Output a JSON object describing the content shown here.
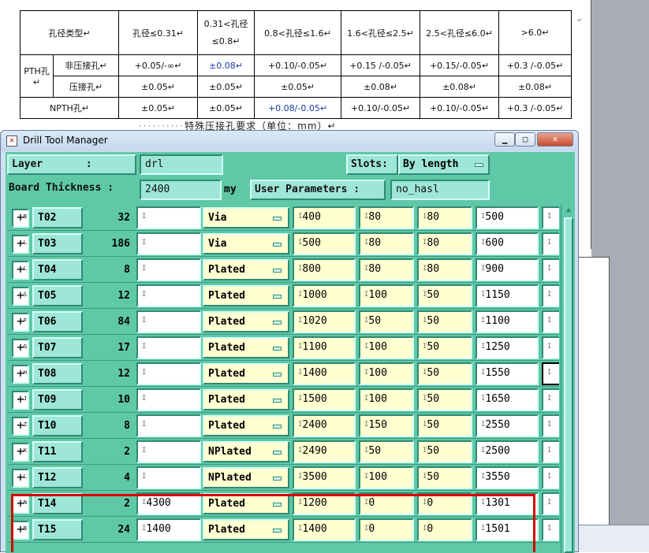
{
  "document": {
    "table": {
      "header": [
        "孔径类型↵",
        "孔径≤0.31↵",
        "0.31<孔径≤0.8↵",
        "0.8<孔径≤1.6↵",
        "1.6<孔径≤2.5↵",
        "2.5<孔径≤6.0↵",
        ">6.0↵"
      ],
      "pth_label": "PTH孔↵",
      "rows": [
        {
          "sub": "非压接孔↵",
          "cells": [
            "+0.05/-∞↵",
            "±0.08↵",
            "+0.10/-0.05↵",
            "+0.15 /-0.05↵",
            "+0.15/-0.05↵",
            "+0.3 /-0.05↵"
          ]
        },
        {
          "sub": "压接孔↵",
          "cells": [
            "±0.05↵",
            "±0.05↵",
            "±0.05↵",
            "±0.08↵",
            "±0.08↵",
            "±0.08↵"
          ]
        },
        {
          "sub": "NPTH孔↵",
          "cells": [
            "±0.05↵",
            "±0.05↵",
            "+0.08/-0.05↵",
            "+0.10/-0.05↵",
            "+0.10/-0.05↵",
            "+0.3 /-0.05↵"
          ]
        }
      ],
      "end_mark": "↵"
    },
    "caption_dots": "··········",
    "caption": "特殊压接孔要求（单位：mm）↵"
  },
  "window": {
    "title": "Drill Tool Manager",
    "icon": "x-window-icon",
    "layer_label": "Layer       :",
    "layer_value": "drl",
    "slots_label": "Slots:",
    "slots_value": "By length",
    "thickness_label": "Board Thickness :",
    "thickness_value": "2400",
    "thickness_unit": "my",
    "user_params_label": "User Parameters :",
    "user_params_value": "no_hasl"
  },
  "tools": [
    {
      "exp": "B",
      "name": "T02",
      "count": "32",
      "c1": "",
      "type": "Via",
      "v1": "400",
      "v2": "80",
      "v3": "80",
      "v4": "500"
    },
    {
      "exp": "L",
      "name": "T03",
      "count": "186",
      "c1": "",
      "type": "Via",
      "v1": "500",
      "v2": "80",
      "v3": "80",
      "v4": "600"
    },
    {
      "exp": "L",
      "name": "T04",
      "count": "8",
      "c1": "",
      "type": "Plated",
      "v1": "800",
      "v2": "80",
      "v3": "80",
      "v4": "900"
    },
    {
      "exp": "S",
      "name": "T05",
      "count": "12",
      "c1": "",
      "type": "Plated",
      "v1": "1000",
      "v2": "100",
      "v3": "50",
      "v4": "1150"
    },
    {
      "exp": "F",
      "name": "T06",
      "count": "84",
      "c1": "",
      "type": "Plated",
      "v1": "1020",
      "v2": "50",
      "v3": "50",
      "v4": "1100"
    },
    {
      "exp": "G",
      "name": "T07",
      "count": "17",
      "c1": "",
      "type": "Plated",
      "v1": "1100",
      "v2": "100",
      "v3": "50",
      "v4": "1250"
    },
    {
      "exp": "H",
      "name": "T08",
      "count": "12",
      "c1": "",
      "type": "Plated",
      "v1": "1400",
      "v2": "100",
      "v3": "50",
      "v4": "1550"
    },
    {
      "exp": "J",
      "name": "T09",
      "count": "10",
      "c1": "",
      "type": "Plated",
      "v1": "1500",
      "v2": "100",
      "v3": "50",
      "v4": "1650"
    },
    {
      "exp": "Z",
      "name": "T10",
      "count": "8",
      "c1": "",
      "type": "Plated",
      "v1": "2400",
      "v2": "150",
      "v3": "50",
      "v4": "2550"
    },
    {
      "exp": "K",
      "name": "T11",
      "count": "2",
      "c1": "",
      "type": "NPlated",
      "v1": "2490",
      "v2": "50",
      "v3": "50",
      "v4": "2500"
    },
    {
      "exp": "L",
      "name": "T12",
      "count": "4",
      "c1": "",
      "type": "NPlated",
      "v1": "3500",
      "v2": "100",
      "v3": "50",
      "v4": "3550"
    },
    {
      "exp": "N",
      "name": "T14",
      "count": "2",
      "c1": "4300",
      "type": "Plated",
      "v1": "1200",
      "v2": "0",
      "v3": "0",
      "v4": "1301"
    },
    {
      "exp": "B",
      "name": "T15",
      "count": "24",
      "c1": "1400",
      "type": "Plated",
      "v1": "1400",
      "v2": "0",
      "v3": "0",
      "v4": "1501"
    }
  ],
  "colors": {
    "panel": "#5fc8a6",
    "button": "#9ee6d8",
    "yellow_cell": "#ffffd2",
    "highlight": "#d40000"
  }
}
